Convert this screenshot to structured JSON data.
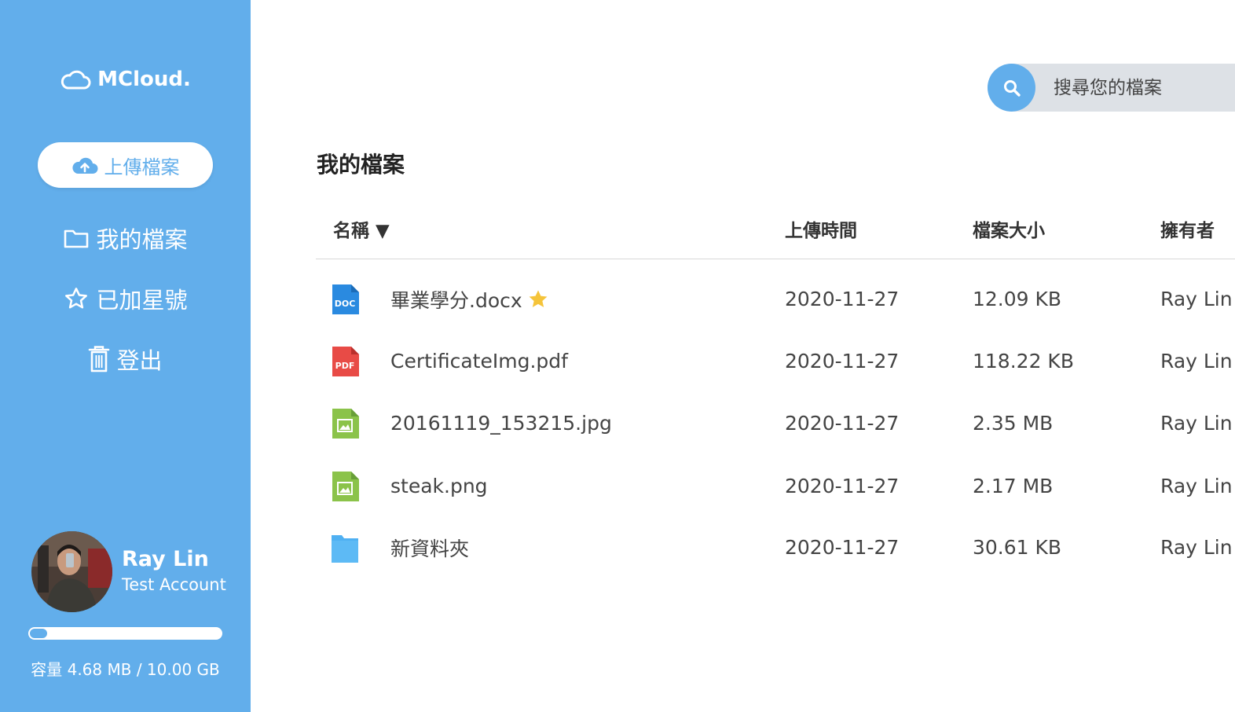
{
  "app": {
    "name": "MCloud."
  },
  "sidebar": {
    "upload_label": "上傳檔案",
    "nav": [
      {
        "label": "我的檔案",
        "icon": "folder-outline-icon"
      },
      {
        "label": "已加星號",
        "icon": "star-outline-icon"
      },
      {
        "label": "登出",
        "icon": "trash-icon"
      }
    ],
    "user": {
      "name": "Ray Lin",
      "role": "Test Account"
    },
    "storage": {
      "label": "容量 4.68 MB / 10.00 GB",
      "used_fraction": 0.0005
    }
  },
  "search": {
    "placeholder": "搜尋您的檔案"
  },
  "main": {
    "title": "我的檔案",
    "columns": {
      "name": "名稱 ▼",
      "date": "上傳時間",
      "size": "檔案大小",
      "owner": "擁有者"
    },
    "files": [
      {
        "name": "畢業學分.docx",
        "type": "doc",
        "starred": true,
        "date": "2020-11-27",
        "size": "12.09 KB",
        "owner": "Ray Lin"
      },
      {
        "name": "CertificateImg.pdf",
        "type": "pdf",
        "starred": false,
        "date": "2020-11-27",
        "size": "118.22 KB",
        "owner": "Ray Lin"
      },
      {
        "name": "20161119_153215.jpg",
        "type": "image",
        "starred": false,
        "date": "2020-11-27",
        "size": "2.35 MB",
        "owner": "Ray Lin"
      },
      {
        "name": "steak.png",
        "type": "image",
        "starred": false,
        "date": "2020-11-27",
        "size": "2.17 MB",
        "owner": "Ray Lin"
      },
      {
        "name": "新資料夾",
        "type": "folder",
        "starred": false,
        "date": "2020-11-27",
        "size": "30.61 KB",
        "owner": "Ray Lin"
      }
    ]
  },
  "colors": {
    "accent": "#62aeeb",
    "doc": "#2a8ae0",
    "pdf": "#e84b46",
    "image": "#8bc34a",
    "folder": "#4fb0f2",
    "star": "#f5c43a"
  }
}
